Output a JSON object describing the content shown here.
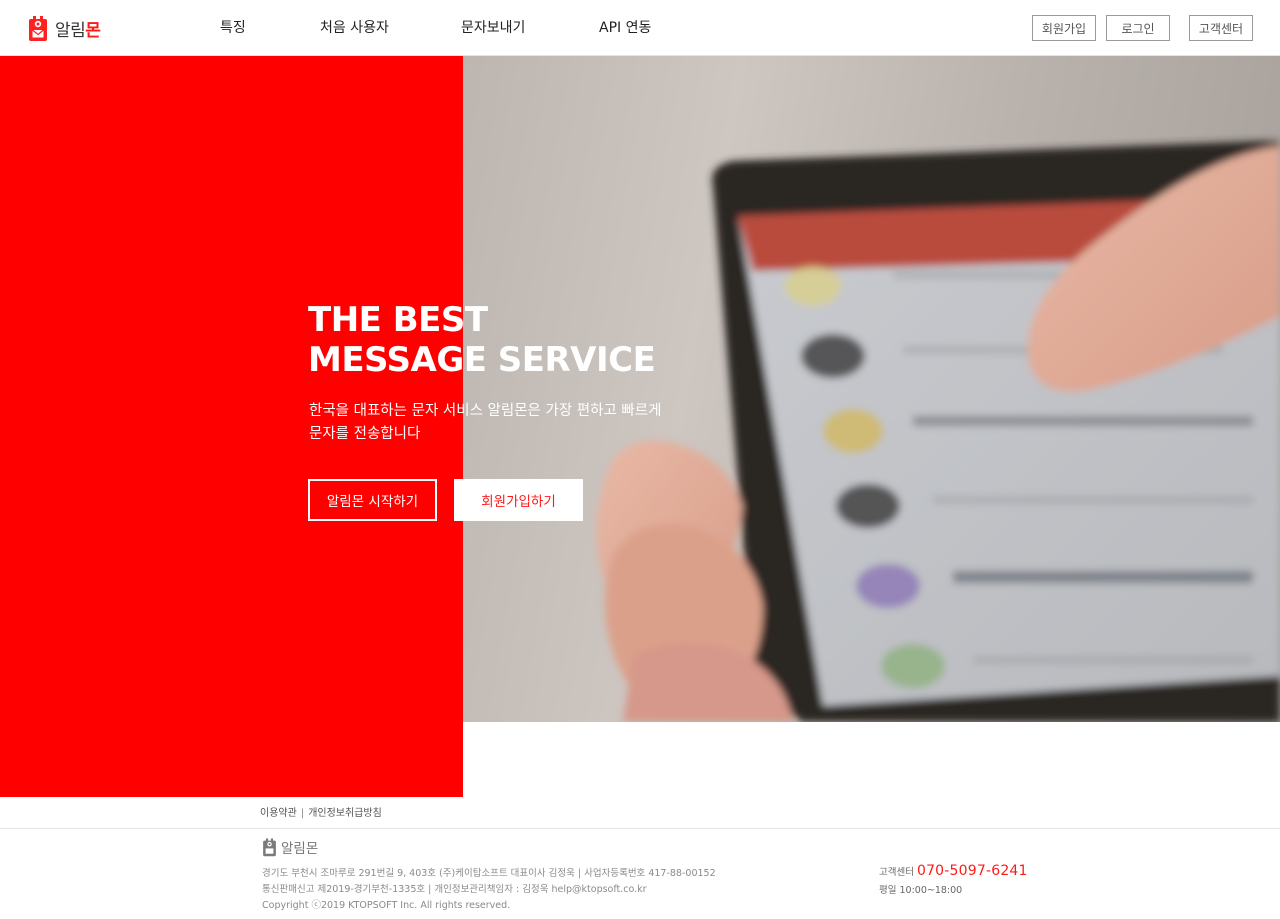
{
  "brand": {
    "name_prefix": "알림",
    "name_accent": "몬",
    "footer_name": "알림몬"
  },
  "nav": [
    {
      "label": "특징"
    },
    {
      "label": "처음 사용자"
    },
    {
      "label": "문자보내기"
    },
    {
      "label": "API 연동"
    }
  ],
  "header_buttons": {
    "signup": "회원가입",
    "login": "로그인",
    "support": "고객센터"
  },
  "hero": {
    "title_line1": "THE BEST",
    "title_line2": "MESSAGE SERVICE",
    "subtitle_line1": "한국을 대표하는 문자 서비스 알림몬은 가장 편하고 빠르게",
    "subtitle_line2": "문자를 전송합니다",
    "start_button": "알림몬 시작하기",
    "join_button": "회원가입하기"
  },
  "footer": {
    "terms_link": "이용약관",
    "privacy_link": "개인정보취급방침",
    "separator": "|",
    "info_line1": "경기도 부천시 조마루로 291번길 9, 403호 (주)케이탑소프트  대표이사  김정욱  | 사업자등록번호 417-88-00152",
    "info_line2": "통신판매신고 제2019-경기부천-1335호 | 개인정보관리책임자 : 김정욱  help@ktopsoft.co.kr",
    "copyright": "Copyright ⓒ2019 KTOPSOFT Inc. All rights reserved.",
    "cs_label": "고객센터",
    "cs_phone": "070-5097-6241",
    "cs_hours": "평일 10:00~18:00"
  },
  "colors": {
    "accent": "#ff0000",
    "text_dark": "#222222",
    "footer_text": "#8a8a8a"
  }
}
